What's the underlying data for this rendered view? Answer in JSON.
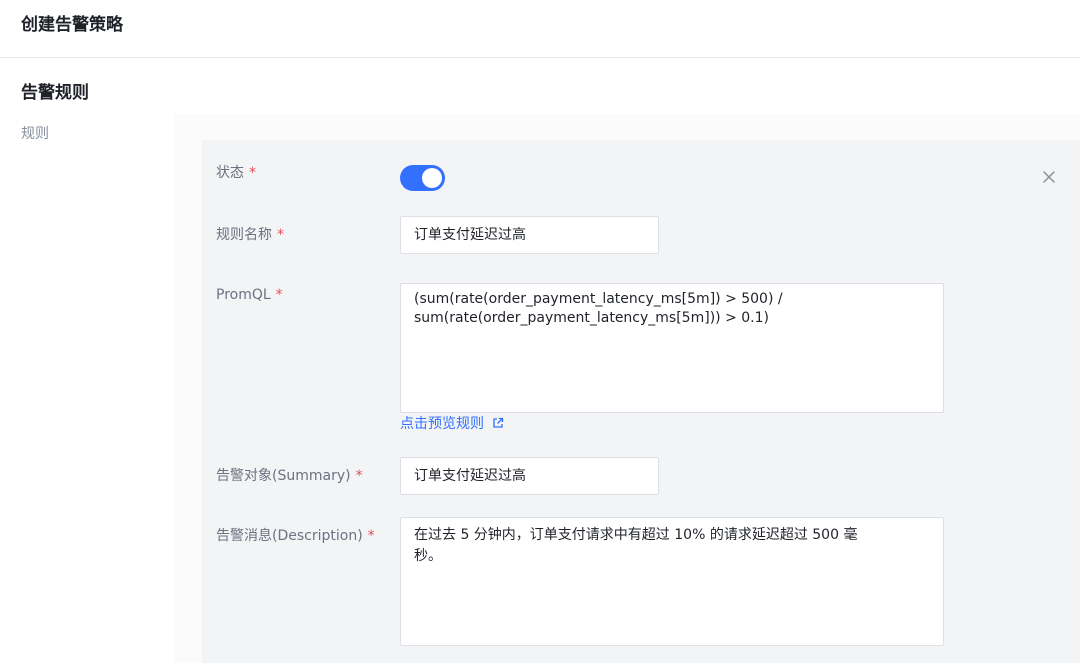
{
  "header": {
    "title": "创建告警策略"
  },
  "section": {
    "title": "告警规则",
    "side_label": "规则"
  },
  "form": {
    "close_icon": "close-icon",
    "required_mark": "*",
    "status": {
      "label": "状态",
      "enabled": true,
      "accent_color": "#3370ff"
    },
    "rule_name": {
      "label": "规则名称",
      "value": "订单支付延迟过高"
    },
    "promql": {
      "label": "PromQL",
      "lines": [
        "(sum(rate(order_payment_latency_ms[5m]) > 500) /",
        "sum(rate(order_payment_latency_ms[5m])) > 0.1)"
      ],
      "preview_link": "点击预览规则",
      "preview_icon": "external-link-icon"
    },
    "summary": {
      "label": "告警对象(Summary)",
      "value": "订单支付延迟过高"
    },
    "description": {
      "label": "告警消息(Description)",
      "lines": [
        "在过去 5 分钟内，订单支付请求中有超过 10% 的请求延迟超过 500 毫",
        "秒。"
      ]
    }
  }
}
